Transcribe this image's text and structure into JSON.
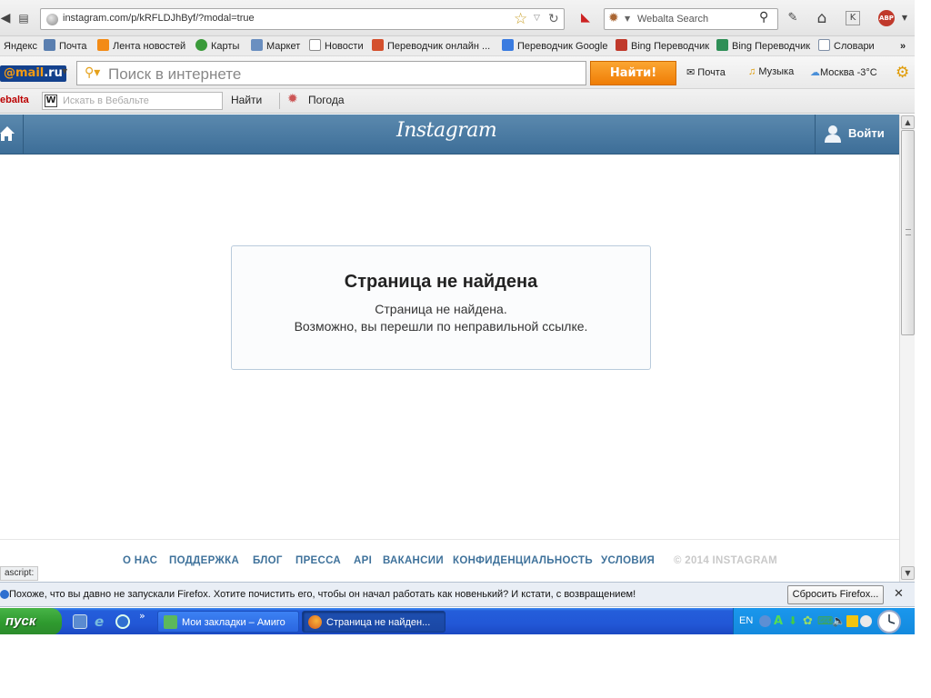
{
  "browser": {
    "url": "instagram.com/p/kRFLDJhByf/?modal=true",
    "search_engine_placeholder": "Webalta Search"
  },
  "bookmarks": [
    {
      "label": "Яндекс",
      "icon": "yandex-icon",
      "color": "#d22"
    },
    {
      "label": "Почта",
      "icon": "mail-icon",
      "color": "#5a7fb0"
    },
    {
      "label": "Лента новостей",
      "icon": "rss-icon",
      "color": "#f38b16"
    },
    {
      "label": "Карты",
      "icon": "maps-icon",
      "color": "#3a9a3a"
    },
    {
      "label": "Маркет",
      "icon": "market-icon",
      "color": "#6a8fc0"
    },
    {
      "label": "Новости",
      "icon": "news-icon",
      "color": "#8a8a8a"
    },
    {
      "label": "Переводчик онлайн ...",
      "icon": "translator-icon",
      "color": "#d4502d"
    },
    {
      "label": "Переводчик Google",
      "icon": "google-translate-icon",
      "color": "#3a7be0"
    },
    {
      "label": "Bing Переводчик",
      "icon": "bing-icon",
      "color": "#c0392b"
    },
    {
      "label": "Bing Переводчик",
      "icon": "bing-translate-icon",
      "color": "#2f8f57"
    },
    {
      "label": "Словари",
      "icon": "dictionary-icon",
      "color": "#7f8fa6"
    }
  ],
  "mailbar": {
    "logo_prefix": "@mail",
    "logo_suffix": ".ru",
    "search_placeholder": "Поиск в интернете",
    "find_label": "Найти!",
    "mail_label": "Почта",
    "music_label": "Музыка",
    "weather_label": "Москва -3°C"
  },
  "webaltabar": {
    "logo": "ebalta",
    "placeholder": "Искать в Вебальте",
    "find_label": "Найти",
    "weather_label": "Погода"
  },
  "instagram": {
    "logo": "Instagram",
    "login_label": "Войти",
    "error_title": "Страница не найдена",
    "error_line1": "Страница не найдена.",
    "error_line2": "Возможно, вы перешли по неправильной ссылке.",
    "footer_links": [
      "О НАС",
      "ПОДДЕРЖКА",
      "БЛОГ",
      "ПРЕССА",
      "API",
      "ВАКАНСИИ",
      "КОНФИДЕНЦИАЛЬНОСТЬ",
      "УСЛОВИЯ"
    ],
    "footer_copyright": "© 2014 INSTAGRAM"
  },
  "status_text": "ascript:",
  "notification": {
    "text": "Похоже, что вы давно не запускали Firefox. Хотите почистить его, чтобы он начал работать как новенький? И кстати, с возвращением!",
    "button_label": "Сбросить Firefox...",
    "close": "✕"
  },
  "taskbar": {
    "start_label": "пуск",
    "tasks": [
      "Мои закладки – Амиго",
      "Страница не найден..."
    ],
    "lang": "EN"
  }
}
